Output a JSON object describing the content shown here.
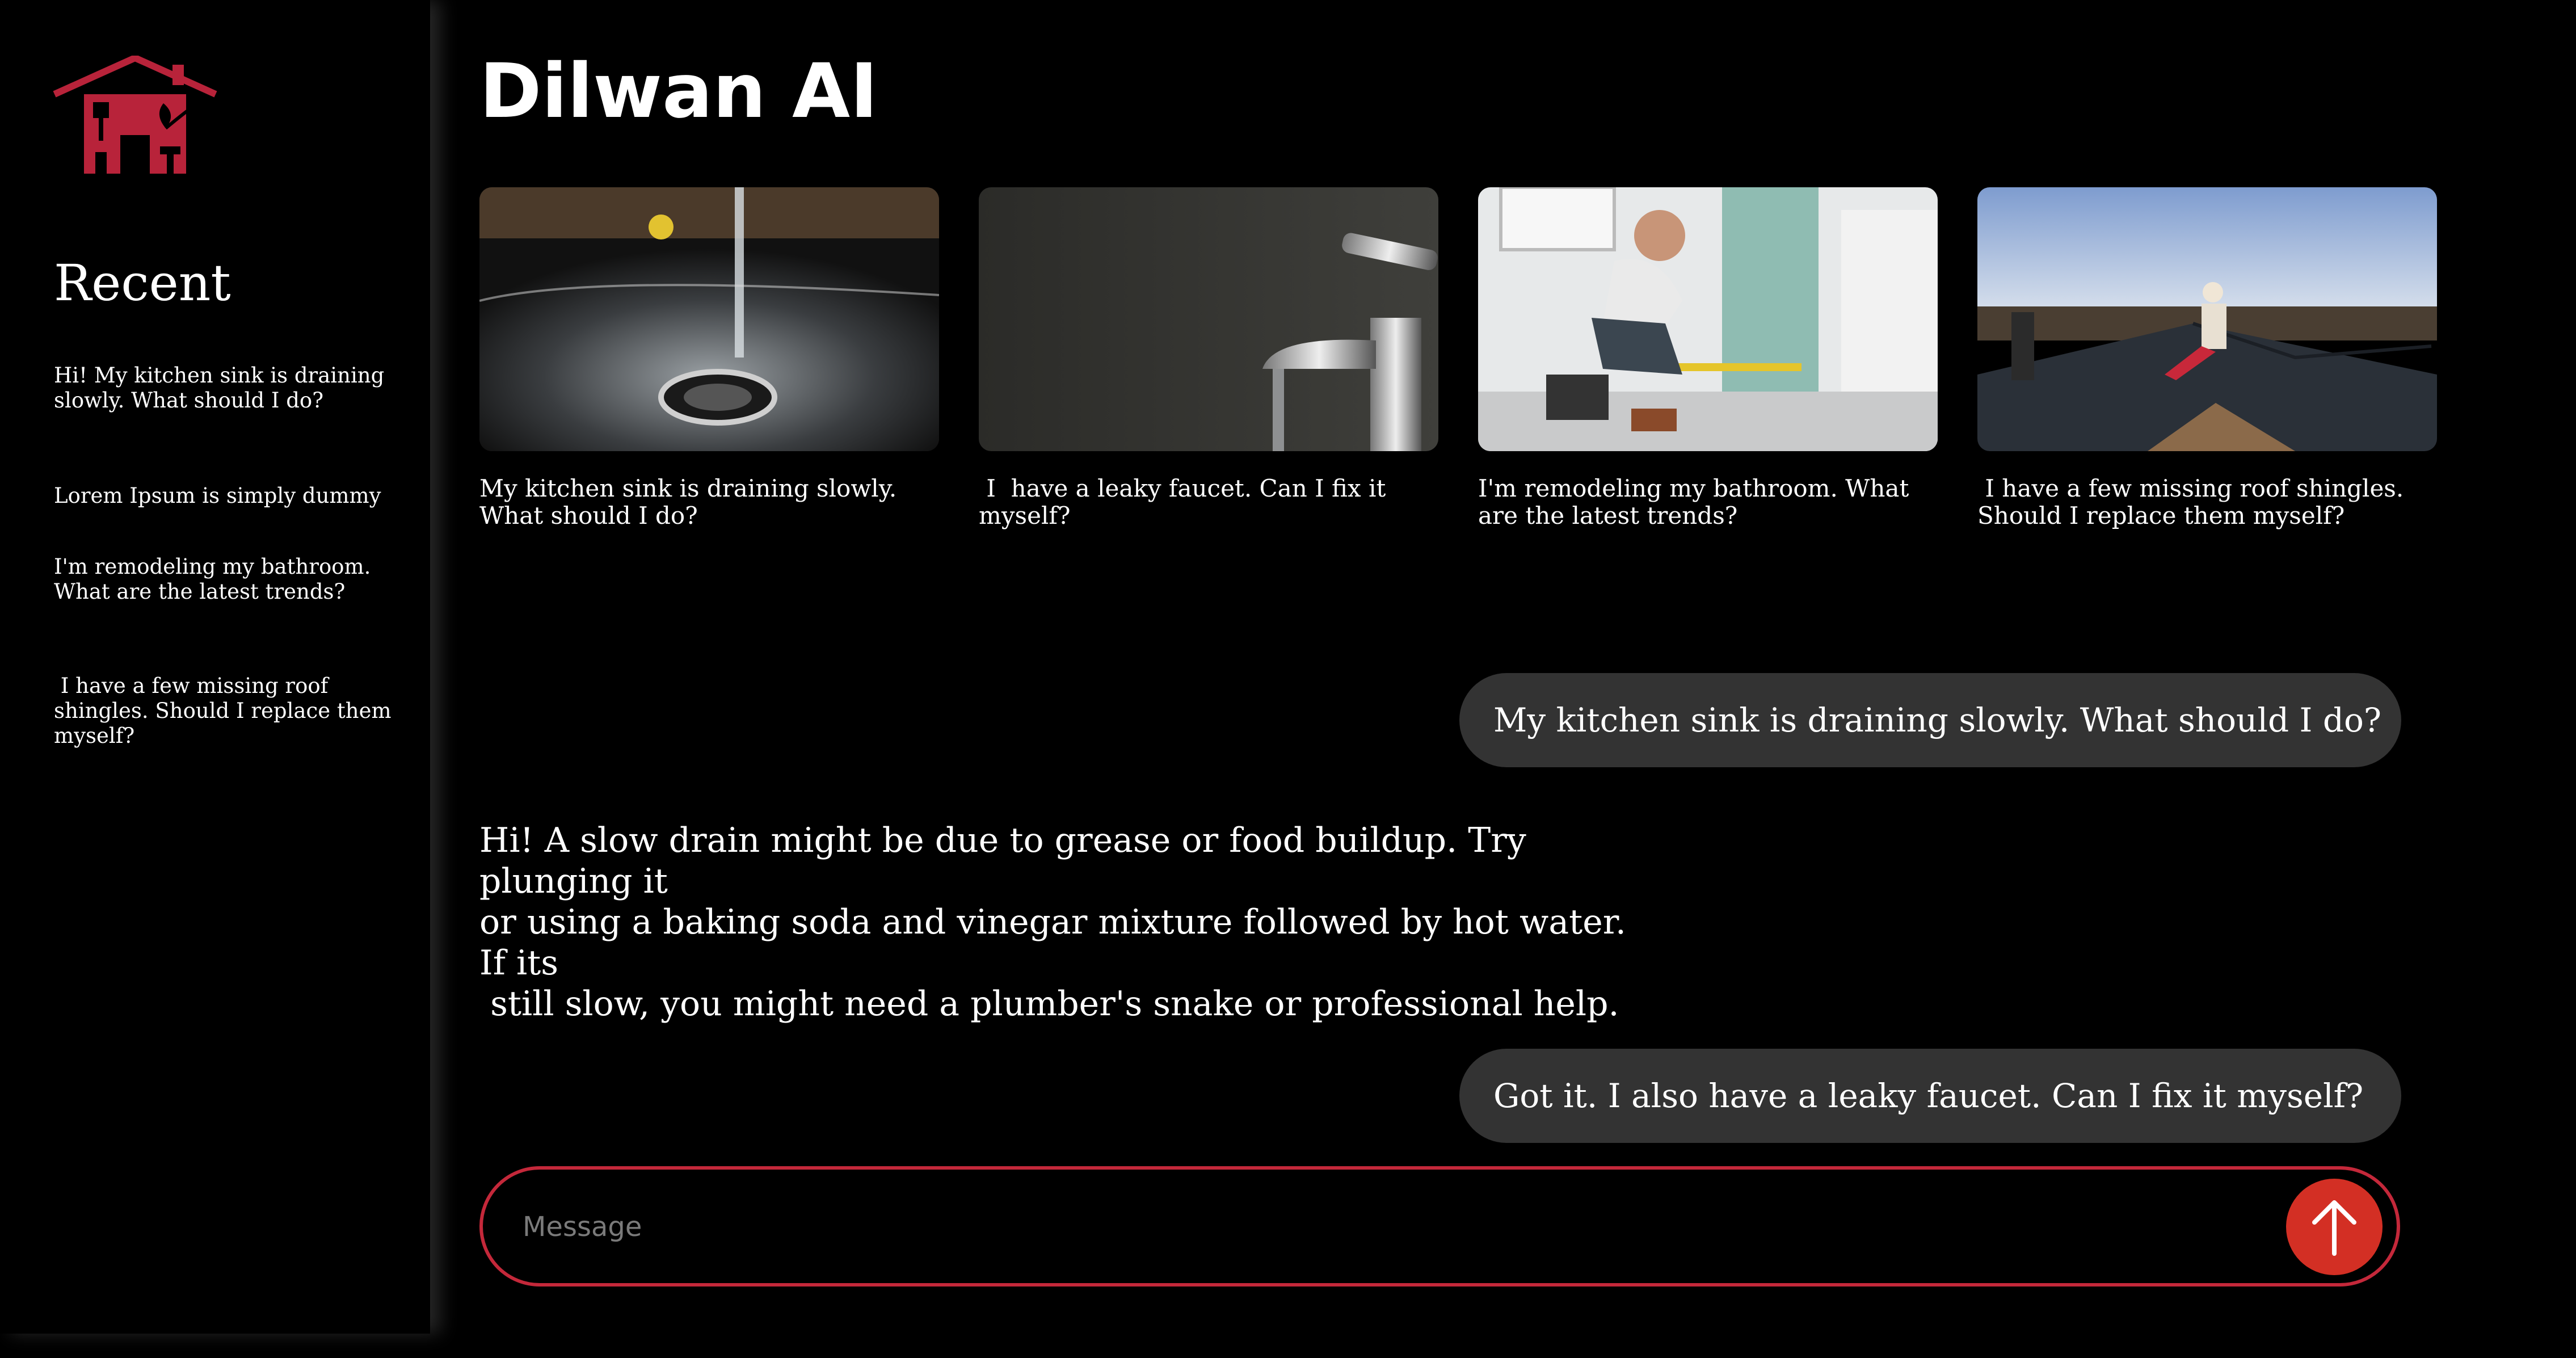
{
  "app": {
    "title": "Dilwan AI"
  },
  "colors": {
    "accent": "#c4283a",
    "send_button": "#d32f24",
    "bubble": "#333333",
    "background": "#000000"
  },
  "sidebar": {
    "logo_icon": "house-tools-logo-icon",
    "recent_title": "Recent",
    "items": [
      {
        "label": "Hi! My kitchen sink is draining\nslowly. What should I do?"
      },
      {
        "label": "Lorem Ipsum is simply dummy"
      },
      {
        "label": "I'm remodeling my bathroom.\nWhat are the latest trends?"
      },
      {
        "label": " I have a few missing roof\nshingles. Should I replace them\nmyself?"
      }
    ]
  },
  "suggestions": [
    {
      "image": "kitchen-sink-draining-image",
      "caption": "My kitchen sink is draining slowly.\nWhat should I do?"
    },
    {
      "image": "leaky-faucet-image",
      "caption": " I  have a leaky faucet. Can I fix it\nmyself?"
    },
    {
      "image": "bathroom-remodel-worker-image",
      "caption": "I'm remodeling my bathroom. What\nare the latest trends?"
    },
    {
      "image": "roof-shingles-worker-image",
      "caption": " I have a few missing roof shingles.\nShould I replace them myself?"
    }
  ],
  "chat": {
    "user_message_1": "My kitchen sink is draining slowly. What should I do?",
    "assistant_message_1": "Hi! A slow drain might be due to grease or food buildup. Try plunging it\nor using a baking soda and vinegar mixture followed by hot water. If its\n still slow, you might need a plumber's snake or professional help.",
    "user_message_2": "Got it. I also have a leaky faucet. Can I fix it myself?"
  },
  "composer": {
    "placeholder": "Message",
    "send_icon": "arrow-up-icon"
  }
}
